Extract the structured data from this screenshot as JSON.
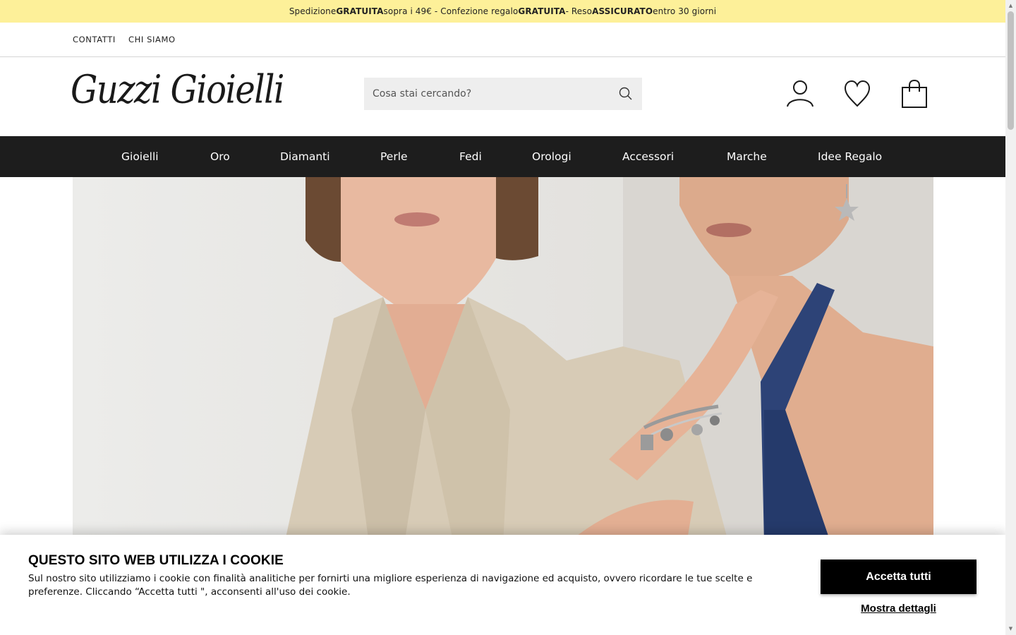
{
  "promo": {
    "t1": "Spedizione ",
    "b1": "GRATUITA",
    "t2": " sopra i 49€ - Confezione regalo ",
    "b2": "GRATUITA",
    "t3": " - Reso ",
    "b3": "ASSICURATO",
    "t4": " entro 30 giorni"
  },
  "utility_links": [
    "CONTATTI",
    "CHI SIAMO"
  ],
  "logo": {
    "text": "Guzzi Gioielli"
  },
  "search": {
    "placeholder": "Cosa stai cercando?",
    "icon": "search-icon"
  },
  "header_icons": [
    "user-icon",
    "heart-icon",
    "shopping-bag-icon"
  ],
  "nav": {
    "items": [
      "Gioielli",
      "Oro",
      "Diamanti",
      "Perle",
      "Fedi",
      "Orologi",
      "Accessori",
      "Marche",
      "Idee Regalo"
    ]
  },
  "hero": {
    "image": "two women wearing silver charm bracelet"
  },
  "cookie": {
    "title": "QUESTO SITO WEB UTILIZZA I COOKIE",
    "text": "Sul nostro sito utilizziamo i cookie con finalità analitiche per fornirti una migliore esperienza di navigazione ed acquisto, ovvero ricordare le tue scelte e preferenze. Cliccando “Accetta tutti \", acconsenti all'uso dei cookie.",
    "accept_label": "Accetta tutti",
    "details_label": "Mostra dettagli"
  },
  "colors": {
    "promo_bg": "#fdf099",
    "nav_bg": "#1d1d1d",
    "search_bg": "#eeeeee",
    "button_bg": "#000000"
  }
}
